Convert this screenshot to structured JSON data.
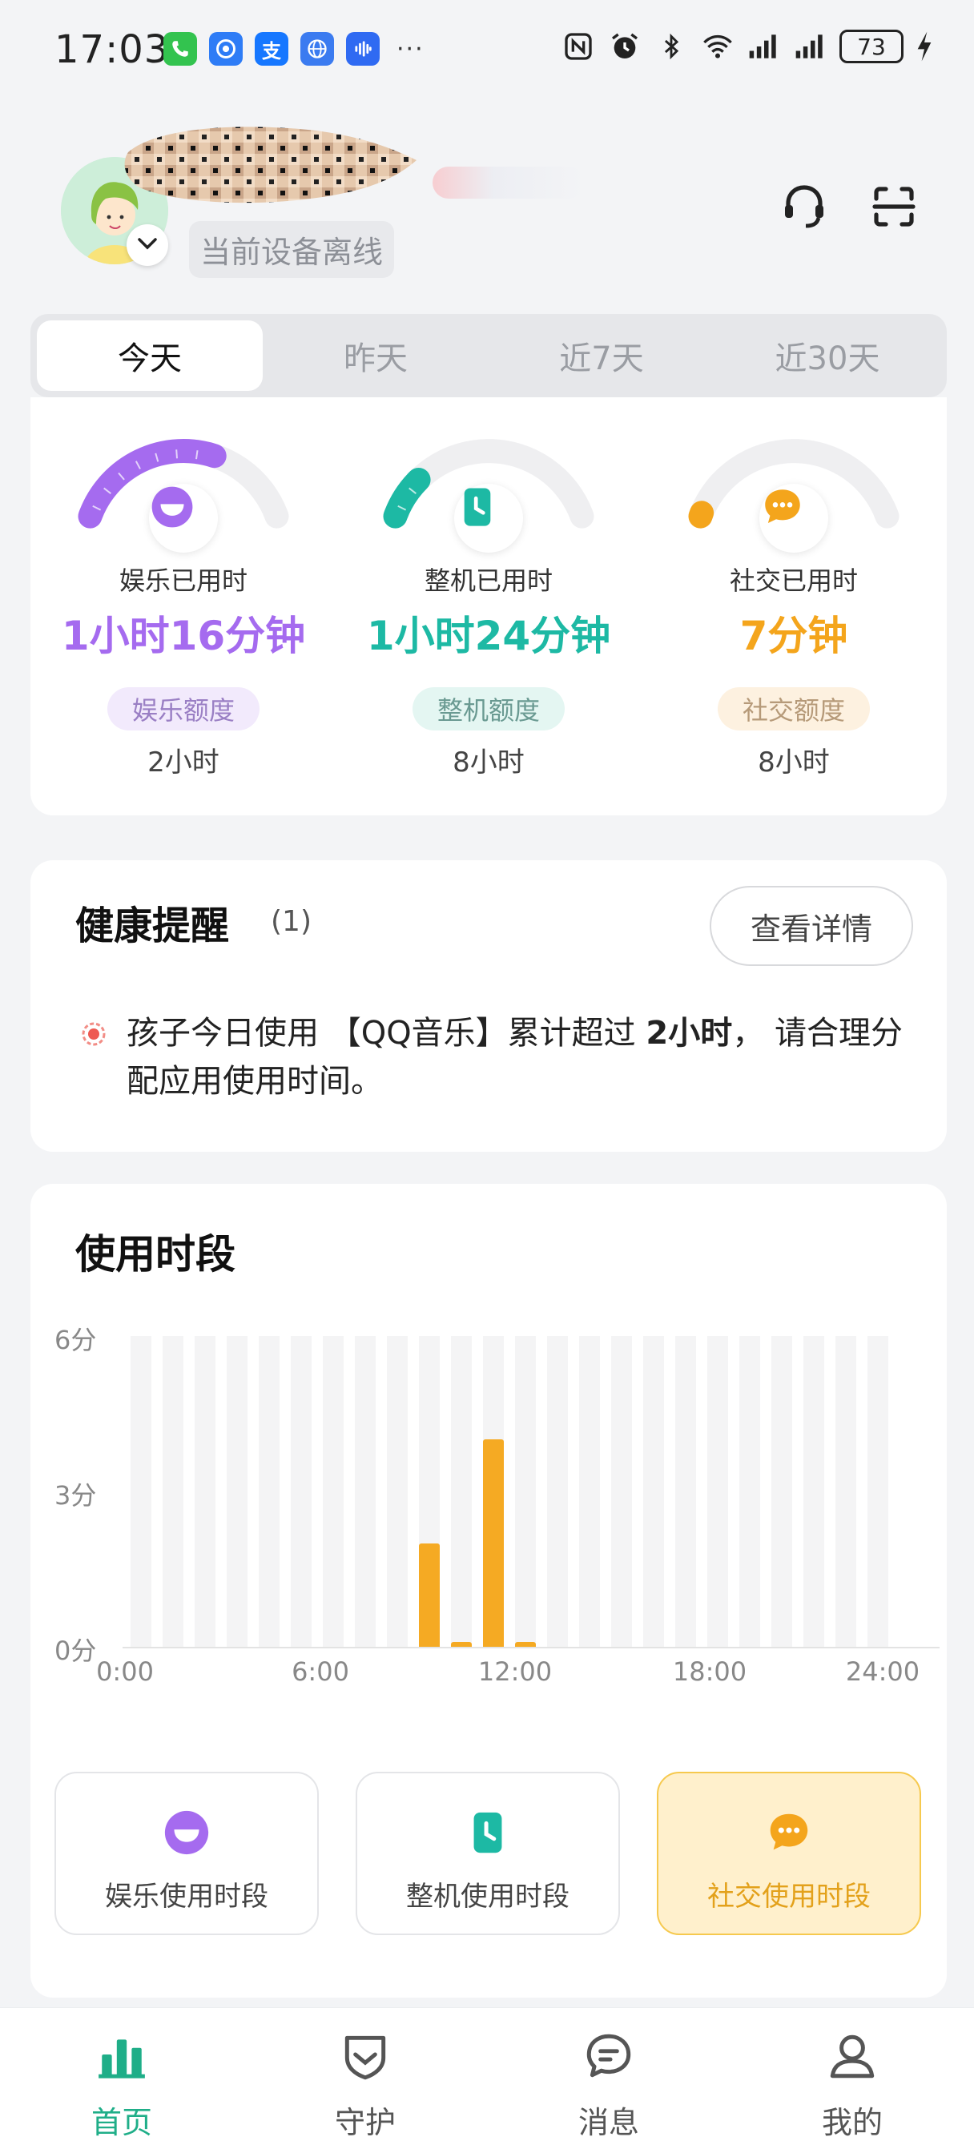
{
  "status_bar": {
    "time": "17:03",
    "dots": "···",
    "battery": "73",
    "apps": [
      {
        "icon": "phone-app-icon",
        "color": "#33c34f"
      },
      {
        "icon": "blue-app-icon",
        "color": "#2e7cf6"
      },
      {
        "icon": "alipay-app-icon",
        "color": "#1677ff",
        "glyph": "支"
      },
      {
        "icon": "browser-app-icon",
        "color": "#3b7bf0"
      },
      {
        "icon": "voice-app-icon",
        "color": "#2f6af2"
      }
    ]
  },
  "header": {
    "device_status": "当前设备离线",
    "support_icon": "headset-icon",
    "scan_icon": "scan-icon"
  },
  "tabs": [
    {
      "label": "今天",
      "active": true
    },
    {
      "label": "昨天",
      "active": false
    },
    {
      "label": "近7天",
      "active": false
    },
    {
      "label": "近30天",
      "active": false
    }
  ],
  "gauges": [
    {
      "label": "娱乐已用时",
      "value": "1小时16分钟",
      "quota_label": "娱乐额度",
      "quota": "2小时",
      "color": "#a56bef",
      "pill_bg": "#f2eafc",
      "pill_color": "#9a7fc4",
      "icon": "smile-icon",
      "progress": 0.63
    },
    {
      "label": "整机已用时",
      "value": "1小时24分钟",
      "quota_label": "整机额度",
      "quota": "8小时",
      "color": "#1db9a4",
      "pill_bg": "#e4f6f2",
      "pill_color": "#6a9a92",
      "icon": "clock-icon",
      "progress": 0.18
    },
    {
      "label": "社交已用时",
      "value": "7分钟",
      "quota_label": "社交额度",
      "quota": "8小时",
      "color": "#f4a51c",
      "pill_bg": "#fdf1e0",
      "pill_color": "#b69a79",
      "icon": "chat-bubble-icon",
      "progress": 0.015
    }
  ],
  "health": {
    "title": "健康提醒",
    "count": "(1)",
    "button": "查看详情",
    "message_prefix": "孩子今日使用 【QQ音乐】累计超过 ",
    "message_bold": "2小时",
    "message_suffix": "， 请合理分配应用使用时间。"
  },
  "usage": {
    "title": "使用时段",
    "modes": [
      {
        "label": "娱乐使用时段",
        "icon": "smile-icon",
        "active": false
      },
      {
        "label": "整机使用时段",
        "icon": "clock-icon",
        "active": false
      },
      {
        "label": "社交使用时段",
        "icon": "chat-bubble-icon",
        "active": true
      }
    ]
  },
  "chart_data": {
    "type": "bar",
    "categories": [
      "0",
      "1",
      "2",
      "3",
      "4",
      "5",
      "6",
      "7",
      "8",
      "9",
      "10",
      "11",
      "12",
      "13",
      "14",
      "15",
      "16",
      "17",
      "18",
      "19",
      "20",
      "21",
      "22",
      "23"
    ],
    "values": [
      0,
      0,
      0,
      0,
      0,
      0,
      0,
      0,
      0,
      2,
      0.1,
      4,
      0.1,
      0,
      0,
      0,
      0,
      0,
      0,
      0,
      0,
      0,
      0,
      0
    ],
    "yticks": [
      "6分",
      "3分",
      "0分"
    ],
    "xticks": [
      "0:00",
      "6:00",
      "12:00",
      "18:00",
      "24:00"
    ],
    "ylim": [
      0,
      6
    ],
    "color": "#f5aa23"
  },
  "nav": [
    {
      "label": "首页",
      "icon": "bar-chart-icon",
      "active": true
    },
    {
      "label": "守护",
      "icon": "shield-icon",
      "active": false
    },
    {
      "label": "消息",
      "icon": "message-icon",
      "active": false
    },
    {
      "label": "我的",
      "icon": "person-icon",
      "active": false
    }
  ]
}
